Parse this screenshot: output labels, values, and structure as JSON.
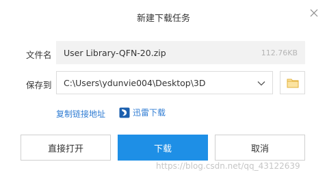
{
  "dialog": {
    "title": "新建下载任务"
  },
  "file_name": {
    "label": "文件名",
    "value": "User Library-QFN-20.zip",
    "size": "112.76KB"
  },
  "save_to": {
    "label": "保存到",
    "path": "C:\\Users\\ydunvie004\\Desktop\\3D"
  },
  "links": {
    "copy_link": "复制链接地址",
    "thunder": "迅雷下载"
  },
  "buttons": {
    "open_directly": "直接打开",
    "download": "下载",
    "cancel": "取消"
  },
  "watermark": "https://blog.csdn.net/qq_43122639",
  "colors": {
    "accent": "#1e8fe6",
    "link": "#2f7cd3",
    "folder": "#f0c24a"
  }
}
